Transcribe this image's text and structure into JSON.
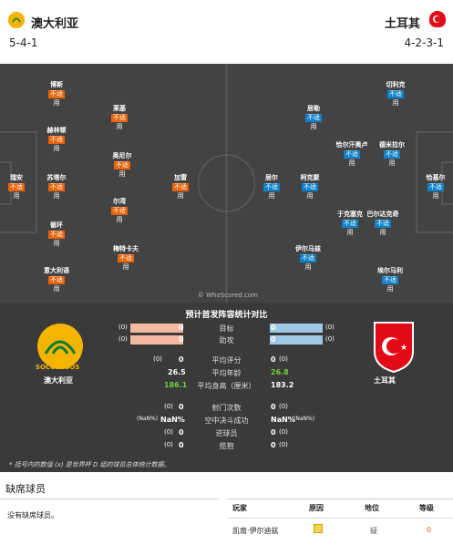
{
  "header": {
    "home": {
      "name": "澳大利亚",
      "formation": "5-4-1"
    },
    "away": {
      "name": "土耳其",
      "formation": "4-2-3-1"
    }
  },
  "status_label": "不适",
  "use_label": "用",
  "home_players": [
    {
      "name": "瑞安",
      "role": "gk"
    },
    {
      "name": "博斯"
    },
    {
      "name": "赫林顿"
    },
    {
      "name": "苏塔尔"
    },
    {
      "name": "循环"
    },
    {
      "name": "意大利语"
    },
    {
      "name": "莱基"
    },
    {
      "name": "奥尼尔"
    },
    {
      "name": "尔湾"
    },
    {
      "name": "梅特卡夫"
    },
    {
      "name": "加雷"
    }
  ],
  "away_players": [
    {
      "name": "恰基尔",
      "role": "gk"
    },
    {
      "name": "切利克"
    },
    {
      "name": "德米拉尔"
    },
    {
      "name": "巴尔达克奇"
    },
    {
      "name": "埃尔马利"
    },
    {
      "name": "恰尔汗奥卢"
    },
    {
      "name": "于克塞克"
    },
    {
      "name": "居勒"
    },
    {
      "name": "柯克聚"
    },
    {
      "name": "伊尔马兹"
    },
    {
      "name": "居尔"
    }
  ],
  "watermark": "© WhoScored.com",
  "stats": {
    "title": "预计首发阵容统计对比",
    "goals": {
      "label": "目标",
      "home": "0",
      "away": "0",
      "home_small": "(0)",
      "away_small": "(0)"
    },
    "assists": {
      "label": "助攻",
      "home": "0",
      "away": "0",
      "home_small": "(0)",
      "away_small": "(0)"
    },
    "rating": {
      "label": "平均评分",
      "home": "0",
      "away": "0",
      "home_small": "(0)",
      "away_small": "(0)"
    },
    "age": {
      "label": "平均年龄",
      "home": "26.5",
      "away": "26.8"
    },
    "height": {
      "label": "平均身高（厘米）",
      "home": "186.1",
      "away": "183.2"
    },
    "shots": {
      "label": "射门次数",
      "home": "0",
      "away": "0",
      "home_small": "(0)",
      "away_small": "(0)"
    },
    "aerial": {
      "label": "空中决斗成功",
      "home": "NaN%",
      "away": "NaN%",
      "home_small": "(NaN%)",
      "away_small": "(NaN%)"
    },
    "passes": {
      "label": "逆球员",
      "home": "0",
      "away": "0",
      "home_small": "(0)",
      "away_small": "(0)"
    },
    "tackles": {
      "label": "揽抱",
      "home": "0",
      "away": "0",
      "home_small": "(0)",
      "away_small": "(0)"
    },
    "home_team": "澳大利亚",
    "away_team": "土耳其",
    "home_logo_text": "SOCCEROOS",
    "note": "* 括号内的数值 (x) 是世界杯 D 组的球员总体统计数据。"
  },
  "missing": {
    "title": "缺席球员",
    "home_text": "没有缺席球员。",
    "headers": [
      "玩家",
      "原因",
      "地位",
      "等级"
    ],
    "rows": [
      {
        "player": "凯南·伊尔迪兹",
        "reason_icon": "warning-icon",
        "status": "疑",
        "rating": "0"
      }
    ]
  },
  "colors": {
    "home_accent": "#e8630a",
    "away_accent": "#0f81c9",
    "pitch": "#434343",
    "green": "#6fcf3c"
  }
}
